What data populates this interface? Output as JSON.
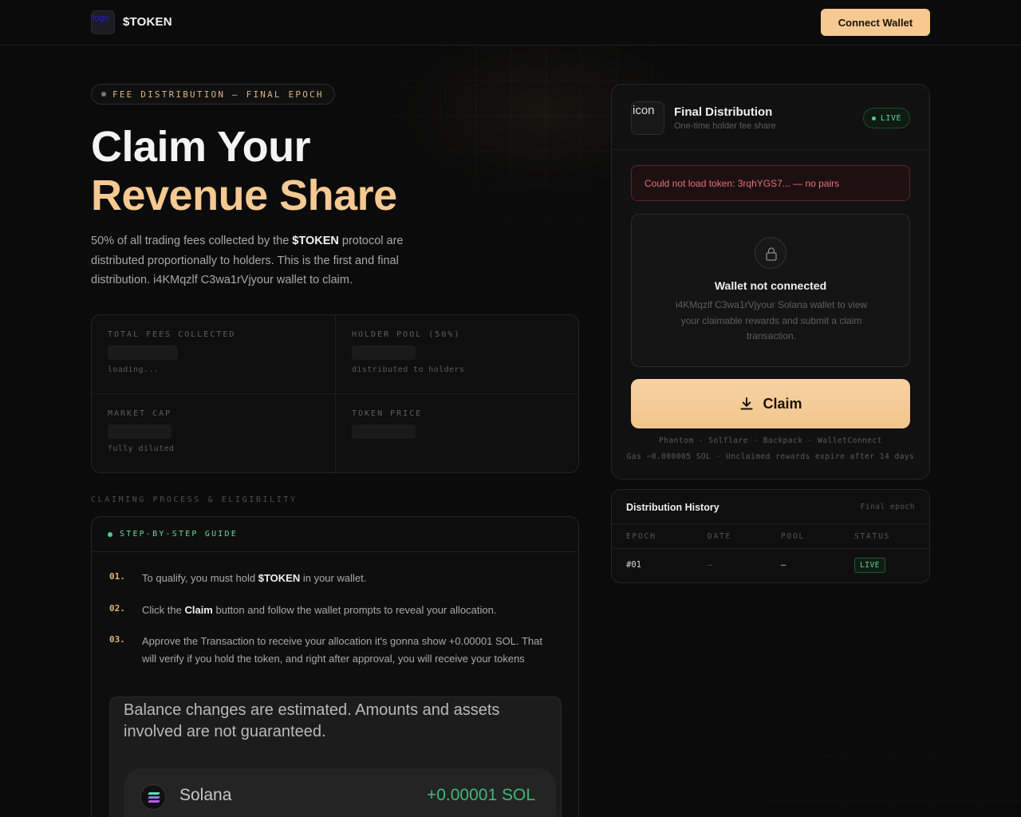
{
  "header": {
    "logo_alt": "logo",
    "brand": "$TOKEN",
    "connect_label": "Connect Wallet"
  },
  "hero": {
    "pill": "FEE DISTRIBUTION — FINAL EPOCH",
    "title_line1": "Claim Your",
    "title_line2": "Revenue Share",
    "desc_pre": "50% of all trading fees collected by the ",
    "desc_token": "$TOKEN",
    "desc_post": " protocol are distributed proportionally to holders. This is the first and final distribution. i4KMqzlf C3wa1rVjyour wallet to claim."
  },
  "stats": [
    {
      "label": "TOTAL FEES COLLECTED",
      "sub": "loading..."
    },
    {
      "label": "HOLDER POOL (50%)",
      "sub": "distributed to holders"
    },
    {
      "label": "MARKET CAP",
      "sub": "fully diluted"
    },
    {
      "label": "TOKEN PRICE",
      "sub": ""
    }
  ],
  "section_label": "CLAIMING PROCESS & ELIGIBILITY",
  "guide": {
    "head": "STEP-BY-STEP GUIDE",
    "steps": [
      {
        "num": "01.",
        "pre": "To qualify, you must hold ",
        "bold": "$TOKEN",
        "post": " in your wallet."
      },
      {
        "num": "02.",
        "pre": "Click the ",
        "bold": "Claim",
        "post": " button and follow the wallet prompts to reveal your allocation."
      },
      {
        "num": "03.",
        "pre": "Approve the Transaction to receive your allocation it's gonna show +0.00001 SOL. That will verify if you hold the token, and right after approval, you will receive your tokens",
        "bold": "",
        "post": ""
      }
    ],
    "preview": {
      "text": "Balance changes are estimated. Amounts and assets involved are not guaranteed.",
      "asset": "Solana",
      "amount": "+0.00001 SOL"
    }
  },
  "card": {
    "icon_alt": "icon",
    "title": "Final Distribution",
    "subtitle": "One-time holder fee share",
    "badge": "LIVE",
    "error": "Could not load token: 3rqhYGS7... — no pairs",
    "wallet_title": "Wallet not connected",
    "wallet_desc": "i4KMqzlf C3wa1rVjyour Solana wallet to view your claimable rewards and submit a claim transaction.",
    "claim_label": "Claim",
    "wallets": "Phantom · Solflare · Backpack · WalletConnect",
    "gas_note": "Gas ~0.000005 SOL · Unclaimed rewards expire after 14 days"
  },
  "history": {
    "title": "Distribution History",
    "tag": "Final epoch",
    "columns": [
      "EPOCH",
      "DATE",
      "POOL",
      "STATUS"
    ],
    "rows": [
      {
        "epoch": "#01",
        "date": "–",
        "pool": "—",
        "status": "LIVE"
      }
    ]
  },
  "colors": {
    "accent": "#f5c991",
    "success": "#4fcf85",
    "error": "#e8707a",
    "background": "#0b0b0b"
  },
  "icons": {
    "card_lock": "lock-icon",
    "claim": "download-icon",
    "asset": "solana-icon"
  }
}
